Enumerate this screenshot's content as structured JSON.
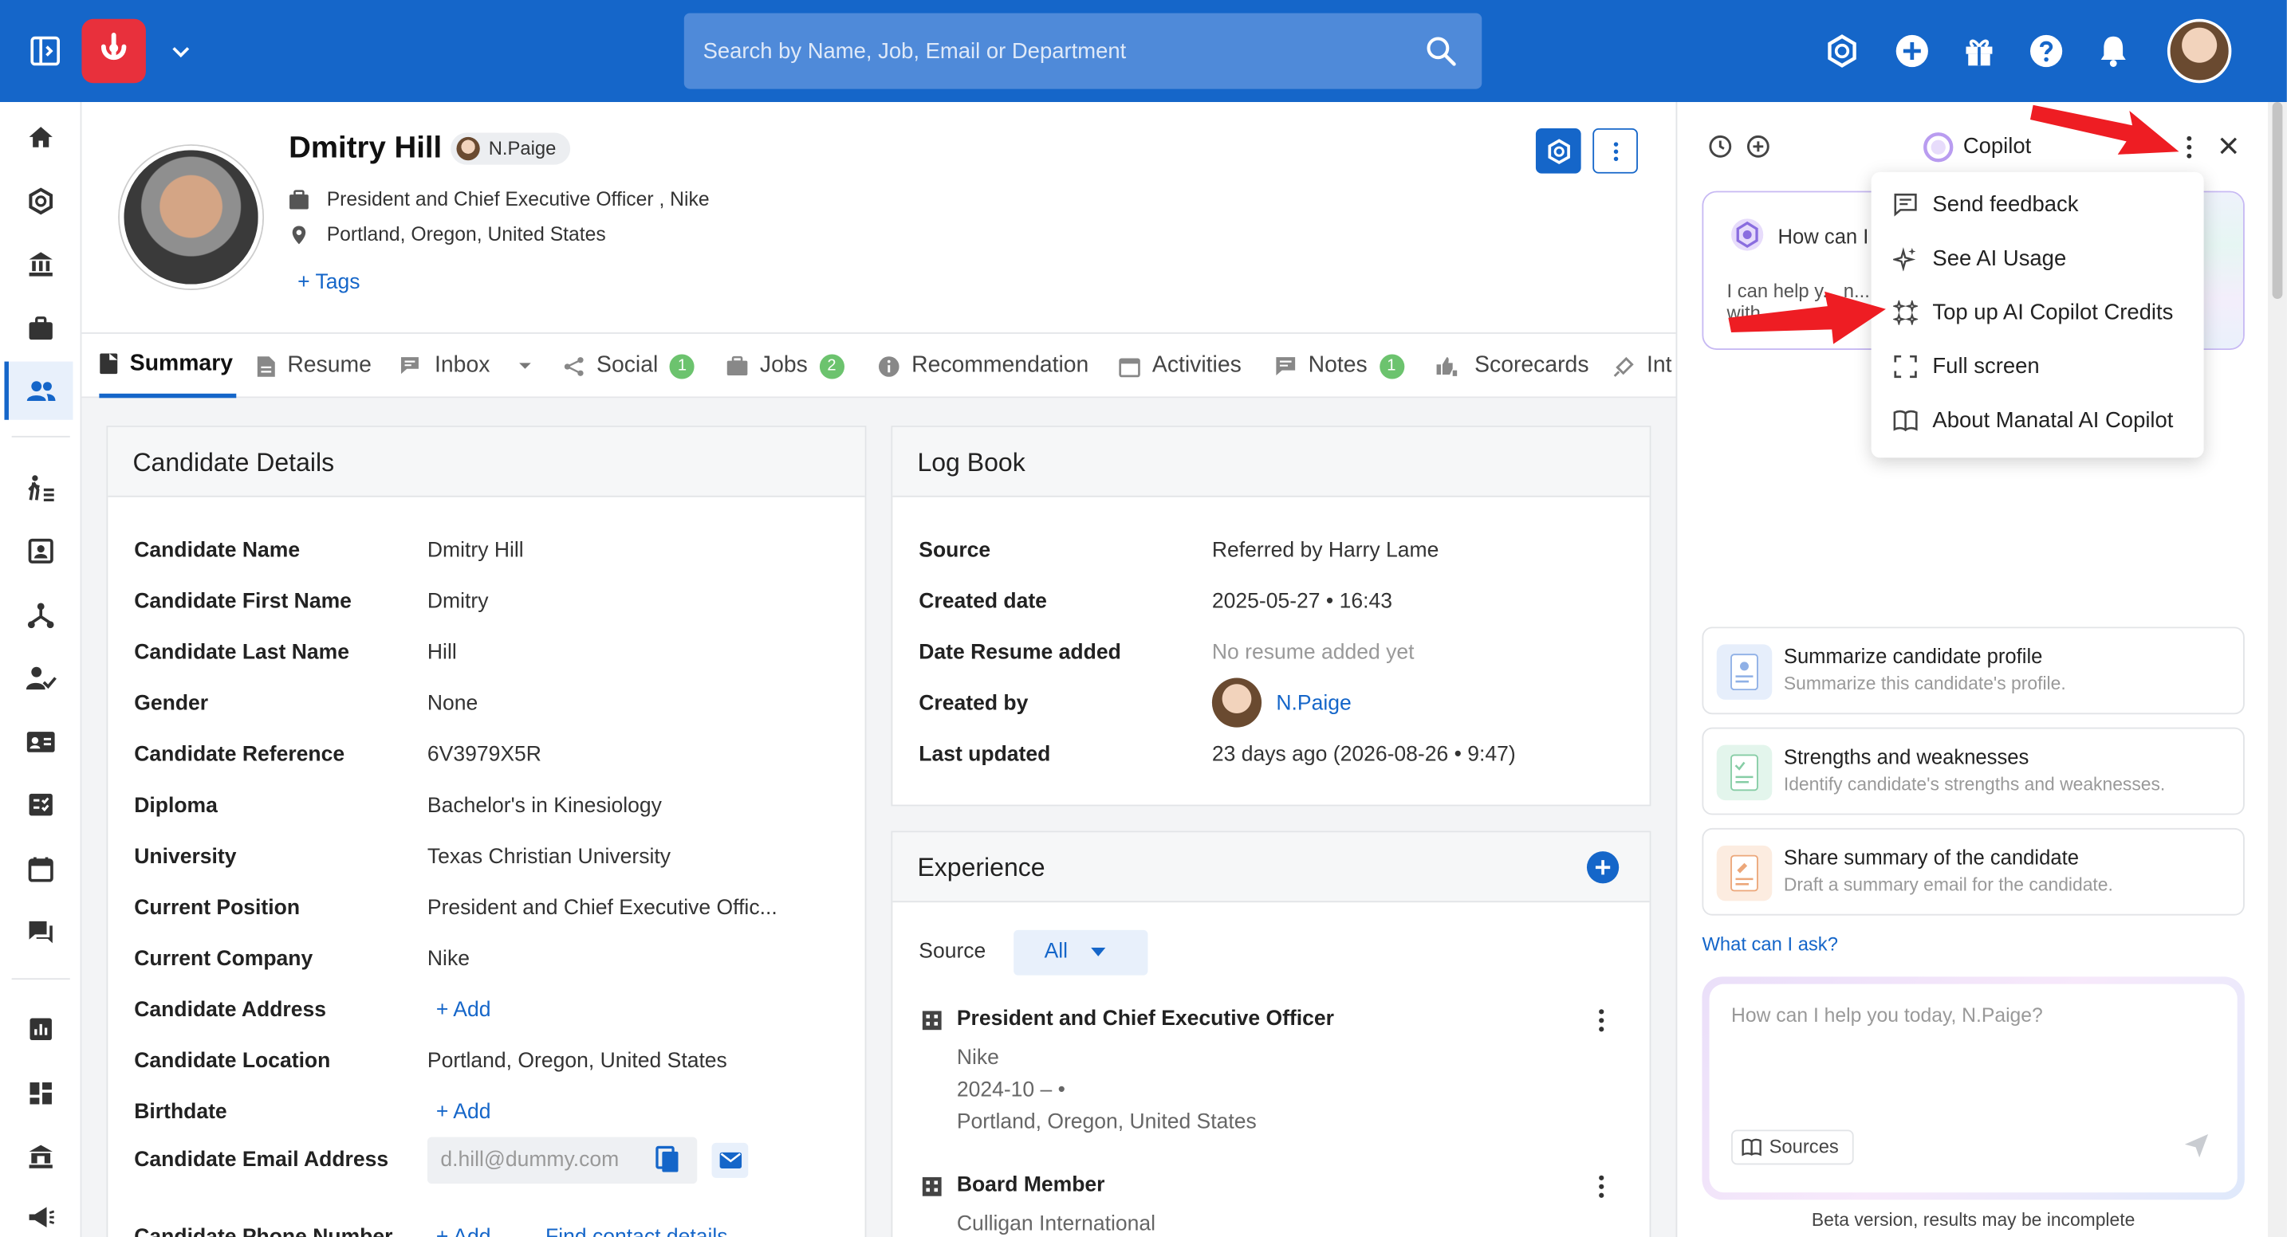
{
  "topbar": {
    "search_placeholder": "Search by Name, Job, Email or Department"
  },
  "colors": {
    "brand": "#1566c9",
    "logo": "#e8303c",
    "badge_green": "#6cc36e",
    "arrow_red": "#ee1d23"
  },
  "sidebar": {
    "items": [
      "home-icon",
      "ai-icon",
      "company-icon",
      "jobs-icon",
      "candidates-icon",
      "pipeline-icon",
      "contacts-icon",
      "org-chart-icon",
      "assign-icon",
      "id-card-icon",
      "tasks-icon",
      "calendar-icon",
      "chat-icon",
      "reports-icon",
      "dashboard-icon",
      "bank-icon",
      "announce-icon"
    ]
  },
  "candidate": {
    "name": "Dmitry Hill",
    "owner": "N.Paige",
    "position_line": "President and Chief Executive Officer , Nike",
    "location": "Portland, Oregon, United States",
    "tags_label": "+ Tags"
  },
  "tabs": [
    {
      "label": "Summary",
      "icon": "summary-icon",
      "count": null
    },
    {
      "label": "Resume",
      "icon": "resume-icon",
      "count": null
    },
    {
      "label": "Inbox",
      "icon": "inbox-icon",
      "count": null
    },
    {
      "label": "Social",
      "icon": "share-icon",
      "count": "1"
    },
    {
      "label": "Jobs",
      "icon": "briefcase-icon",
      "count": "2"
    },
    {
      "label": "Recommendation",
      "icon": "info-icon",
      "count": null
    },
    {
      "label": "Activities",
      "icon": "calendar-icon",
      "count": null
    },
    {
      "label": "Notes",
      "icon": "note-icon",
      "count": "1"
    },
    {
      "label": "Scorecards",
      "icon": "thumbs-icon",
      "count": null
    },
    {
      "label": "Int",
      "icon": "interview-icon",
      "count": null
    }
  ],
  "details": {
    "title": "Candidate Details",
    "rows": [
      {
        "label": "Candidate Name",
        "value": "Dmitry Hill"
      },
      {
        "label": "Candidate First Name",
        "value": "Dmitry"
      },
      {
        "label": "Candidate Last Name",
        "value": "Hill"
      },
      {
        "label": "Gender",
        "value": "None"
      },
      {
        "label": "Candidate Reference",
        "value": "6V3979X5R"
      },
      {
        "label": "Diploma",
        "value": "Bachelor's in Kinesiology"
      },
      {
        "label": "University",
        "value": "Texas Christian University"
      },
      {
        "label": "Current Position",
        "value": "President and Chief Executive Offic..."
      },
      {
        "label": "Current Company",
        "value": "Nike"
      },
      {
        "label": "Candidate Address",
        "value": "+ Add"
      },
      {
        "label": "Candidate Location",
        "value": "Portland, Oregon, United States"
      },
      {
        "label": "Birthdate",
        "value": "+ Add"
      },
      {
        "label": "Candidate Email Address",
        "value": "d.hill@dummy.com"
      },
      {
        "label": "Candidate Phone Number",
        "value": "+ Add"
      }
    ],
    "find_contact": "Find contact details"
  },
  "logbook": {
    "title": "Log Book",
    "rows": [
      {
        "label": "Source",
        "value": "Referred by Harry Lame"
      },
      {
        "label": "Created date",
        "value": "2025-05-27 • 16:43"
      },
      {
        "label": "Date Resume added",
        "value": "No resume added yet"
      },
      {
        "label": "Created by",
        "value": "N.Paige"
      },
      {
        "label": "Last updated",
        "value": "23 days ago (2026-08-26 • 9:47)"
      }
    ]
  },
  "experience": {
    "title": "Experience",
    "source_label": "Source",
    "source_value": "All",
    "items": [
      {
        "title": "President and Chief Executive Officer",
        "company": "Nike",
        "dates": "2024-10 – •",
        "location": "Portland, Oregon, United States"
      },
      {
        "title": "Board Member",
        "company": "Culligan International",
        "dates": "",
        "location": ""
      }
    ]
  },
  "copilot": {
    "title": "Copilot",
    "welcome_title": "How can I",
    "welcome_text": "I can help y... n... with...",
    "suggestions": [
      {
        "title": "Summarize candidate profile",
        "sub": "Summarize this candidate's profile."
      },
      {
        "title": "Strengths and weaknesses",
        "sub": "Identify candidate's strengths and weaknesses."
      },
      {
        "title": "Share summary of the candidate",
        "sub": "Draft a summary email for the candidate."
      }
    ],
    "what_can_i_ask": "What can I ask?",
    "input_placeholder": "How can I help you today, N.Paige?",
    "sources_label": "Sources",
    "beta_note": "Beta version, results may be incomplete"
  },
  "menu": {
    "items": [
      {
        "label": "Send feedback",
        "icon": "feedback-icon"
      },
      {
        "label": "See AI Usage",
        "icon": "sparkle-icon"
      },
      {
        "label": "Top up AI Copilot Credits",
        "icon": "sparkles-icon"
      },
      {
        "label": "Full screen",
        "icon": "fullscreen-icon"
      },
      {
        "label": "About Manatal AI Copilot",
        "icon": "book-icon"
      }
    ]
  }
}
